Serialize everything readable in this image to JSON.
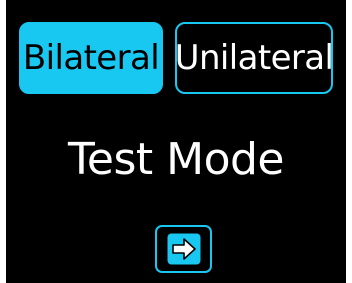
{
  "mode_selector": {
    "options": [
      {
        "label": "Bilateral",
        "selected": true
      },
      {
        "label": "Unilateral",
        "selected": false
      }
    ]
  },
  "title": "Test Mode",
  "next_button": {
    "icon": "arrow-right-icon"
  },
  "colors": {
    "accent": "#19c8f0",
    "background": "#000000",
    "text": "#ffffff"
  }
}
